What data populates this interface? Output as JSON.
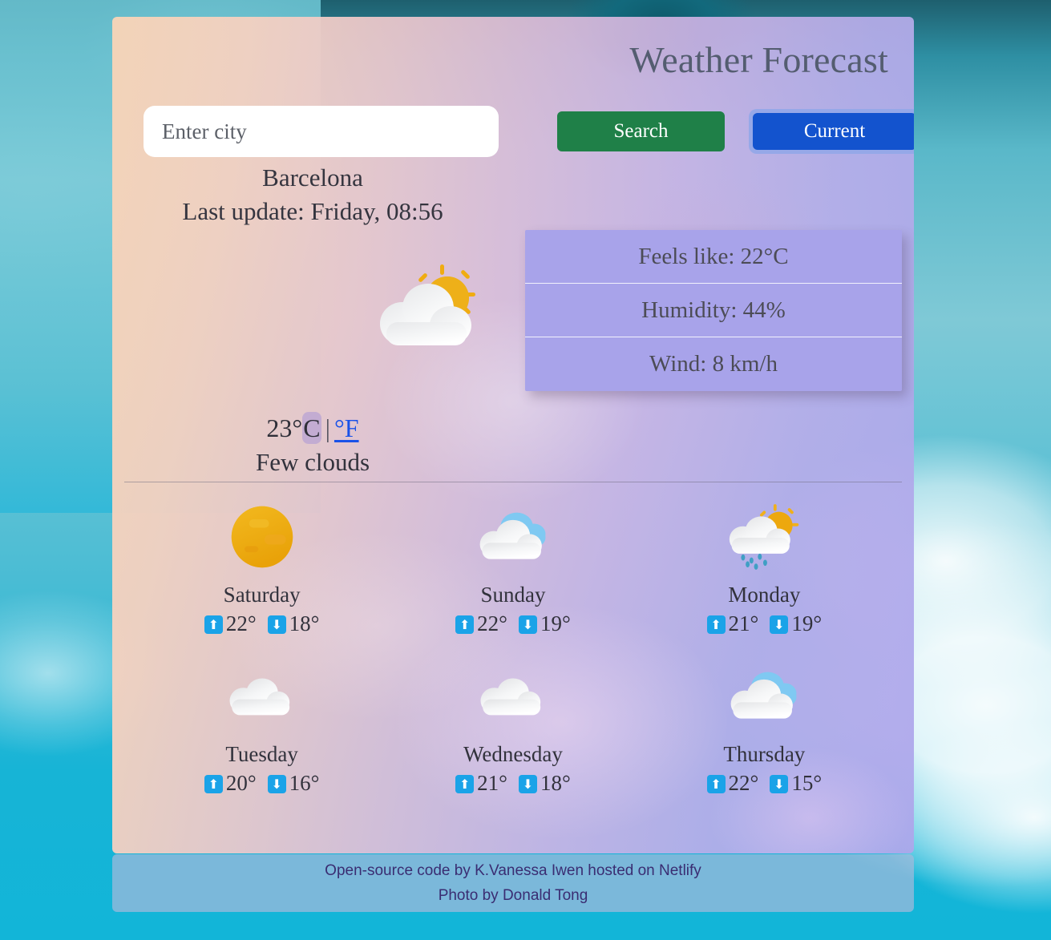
{
  "header": {
    "title": "Weather Forecast"
  },
  "search": {
    "placeholder": "Enter city",
    "value": "",
    "search_label": "Search",
    "current_label": "Current"
  },
  "current": {
    "city": "Barcelona",
    "last_update": "Last update: Friday, 08:56",
    "icon": "sun-behind-cloud-icon",
    "temperature": "23°",
    "unit_active": "C",
    "unit_separator": "|",
    "unit_link": "°F",
    "description": "Few clouds",
    "details": [
      {
        "label": "Feels like: 22°C"
      },
      {
        "label": "Humidity: 44%"
      },
      {
        "label": "Wind: 8 km/h"
      }
    ]
  },
  "forecast": {
    "days": [
      {
        "name": "Saturday",
        "icon": "sun-icon",
        "high": "22°",
        "low": "18°"
      },
      {
        "name": "Sunday",
        "icon": "broken-clouds-icon",
        "high": "22°",
        "low": "19°"
      },
      {
        "name": "Monday",
        "icon": "sun-behind-rain-cloud-icon",
        "high": "21°",
        "low": "19°"
      },
      {
        "name": "Tuesday",
        "icon": "cloud-icon",
        "high": "20°",
        "low": "16°"
      },
      {
        "name": "Wednesday",
        "icon": "cloud-icon",
        "high": "21°",
        "low": "18°"
      },
      {
        "name": "Thursday",
        "icon": "broken-clouds-icon",
        "high": "22°",
        "low": "15°"
      }
    ],
    "up_arrow": "⬆",
    "down_arrow": "⬇"
  },
  "footer": {
    "line1": "Open-source code by K.Vanessa Iwen hosted on Netlify",
    "line2": "Photo by Donald Tong"
  },
  "colors": {
    "search_button": "#1f8048",
    "current_button": "#1353ce",
    "current_button_focus_ring": "#92a7e8",
    "info_panel": "#a8a3ea",
    "unit_link": "#1a52e8",
    "arrow_badge": "#1aa3e8",
    "title_text": "#545d70",
    "sky": "#22b6cf"
  }
}
